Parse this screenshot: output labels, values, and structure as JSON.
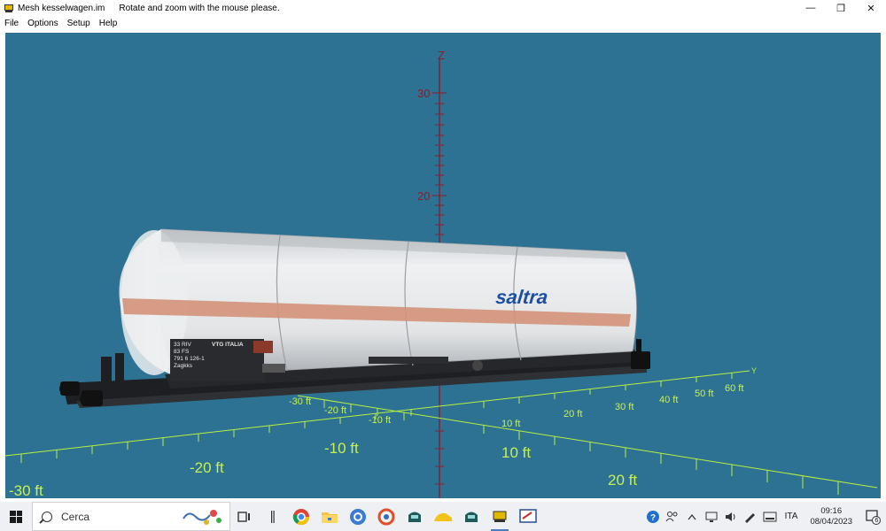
{
  "window": {
    "title": "Mesh kesselwagen.im",
    "hint": "Rotate and zoom with the mouse please.",
    "minimize_glyph": "—",
    "restore_glyph": "❐",
    "close_glyph": "✕"
  },
  "menu": {
    "items": [
      "File",
      "Options",
      "Setup",
      "Help"
    ]
  },
  "viewport": {
    "background": "#2d7292",
    "z_axis_label": "Z",
    "z_ticks": [
      "30",
      "20"
    ],
    "y_axis_label": "Y",
    "ground_labels_small": [
      "-30 ft",
      "-20 ft",
      "-10 ft",
      "10 ft",
      "20 ft",
      "30 ft",
      "40 ft",
      "50 ft",
      "60 ft"
    ],
    "ground_labels_large": [
      "-30 ft",
      "-20 ft",
      "-10 ft",
      "10 ft",
      "20 ft"
    ],
    "wagon": {
      "brand_text": "saltra",
      "plate_lines": [
        "33 RIV",
        "83 FS",
        "791 6 126-1",
        "Zagkks"
      ],
      "plate_operator": "VTG ITALIA"
    },
    "colors": {
      "axis_z": "#8a1e2a",
      "grid_green": "#b8f040",
      "tank": "#e6e8ea",
      "stripe": "#d4927a",
      "brand": "#1c4fa3"
    }
  },
  "taskbar": {
    "search_placeholder": "Cerca",
    "language": "ITA",
    "time": "09:16",
    "date": "08/04/2023",
    "notification_count": "6"
  }
}
